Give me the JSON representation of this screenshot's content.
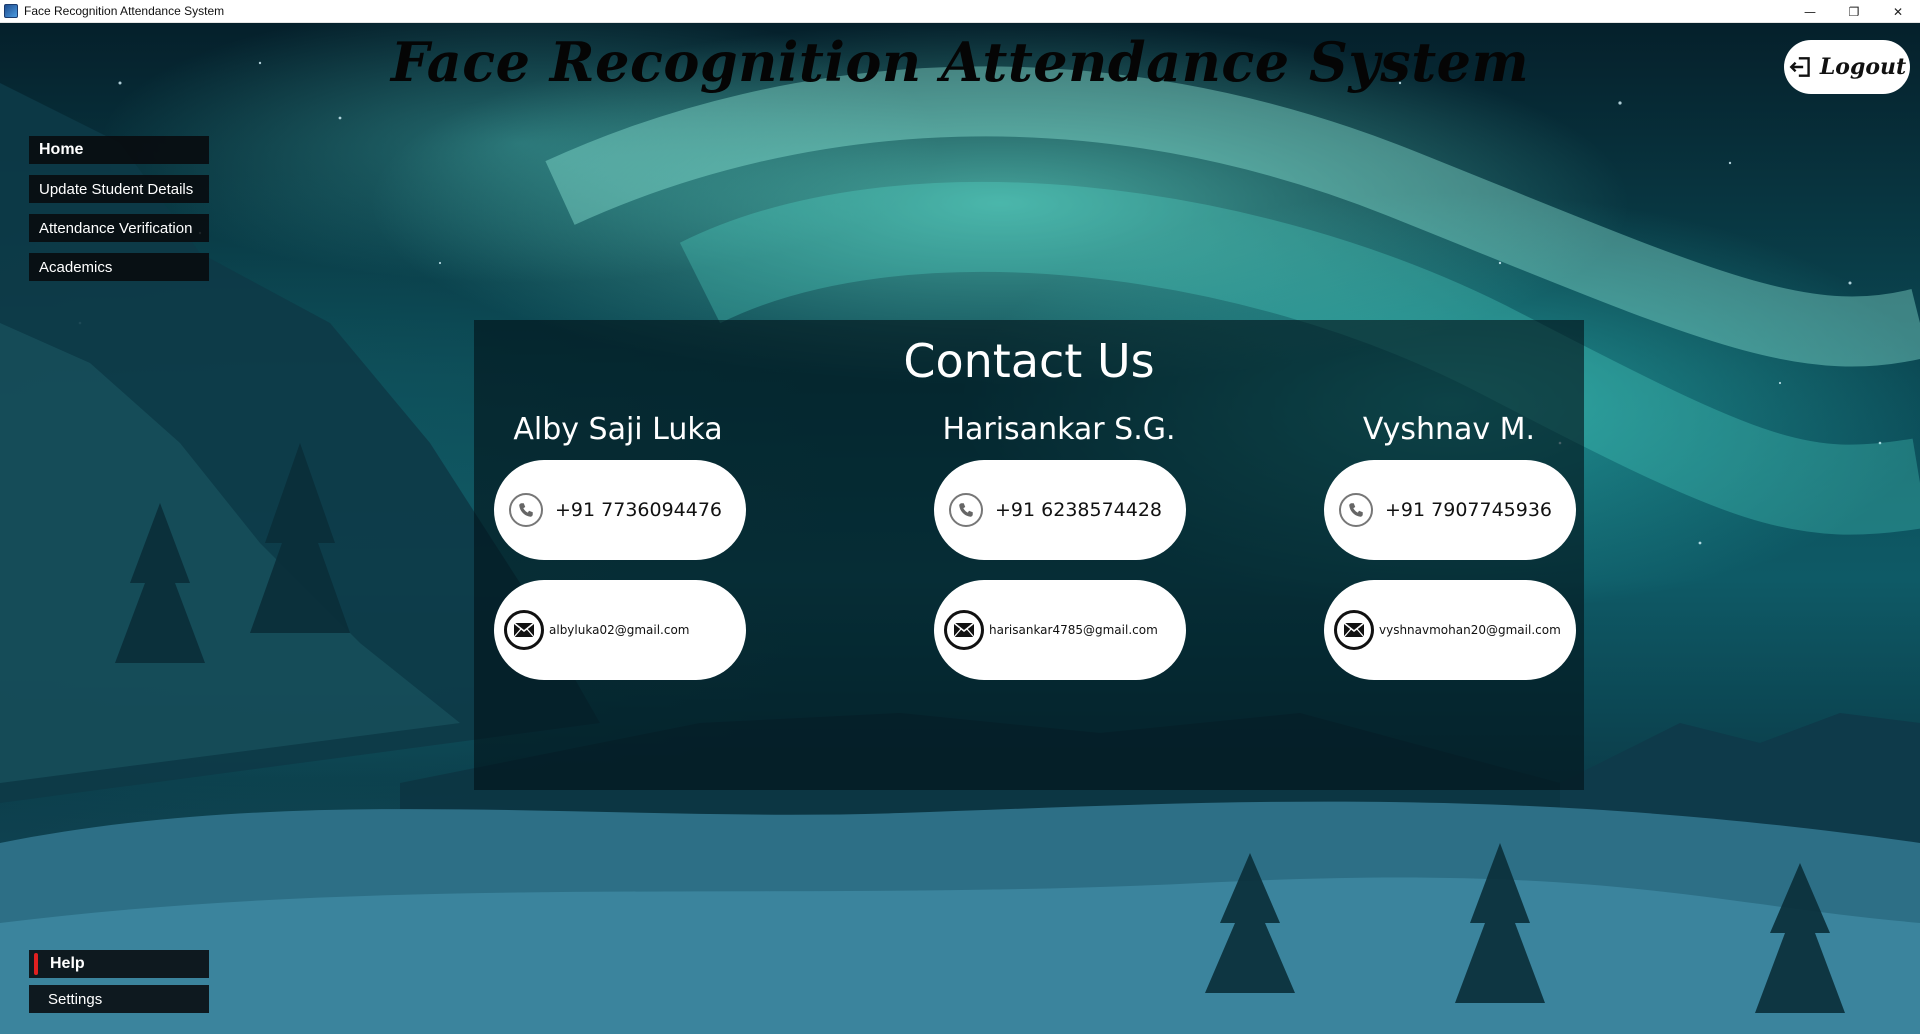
{
  "window": {
    "title": "Face Recognition Attendance System",
    "controls": {
      "minimize": "—",
      "restore": "❐",
      "close": "✕"
    }
  },
  "header": {
    "title": "Face Recognition Attendance System",
    "logout_label": "Logout"
  },
  "sidebar": {
    "items": [
      {
        "label": "Home"
      },
      {
        "label": "Update Student Details"
      },
      {
        "label": "Attendance Verification"
      },
      {
        "label": "Academics"
      }
    ],
    "bottom_items": [
      {
        "label": "Help"
      },
      {
        "label": "Settings"
      }
    ]
  },
  "contact": {
    "title": "Contact Us",
    "people": [
      {
        "name": "Alby Saji Luka",
        "phone": "+91 7736094476",
        "email": "albyluka02@gmail.com"
      },
      {
        "name": "Harisankar S.G.",
        "phone": "+91 6238574428",
        "email": "harisankar4785@gmail.com"
      },
      {
        "name": "Vyshnav M.",
        "phone": "+91 7907745936",
        "email": "vyshnavmohan20@gmail.com"
      }
    ]
  },
  "icons": {
    "phone": "phone-icon",
    "email": "mail-icon",
    "logout": "logout-icon",
    "app": "app-icon"
  },
  "colors": {
    "accent_help": "#e02020",
    "nav_bg": "#080a0e",
    "panel_bg": "#02121a",
    "pill_bg": "#ffffff"
  }
}
